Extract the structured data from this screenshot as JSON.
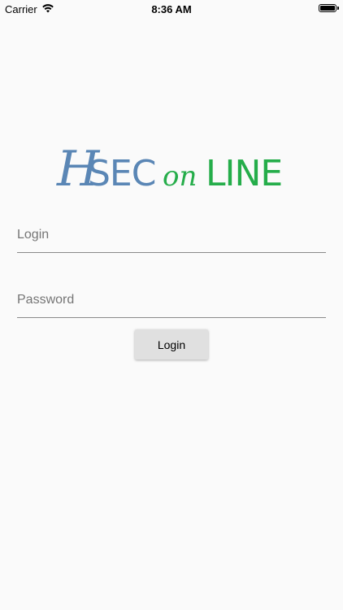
{
  "status_bar": {
    "carrier": "Carrier",
    "time": "8:36 AM"
  },
  "logo": {
    "part_h": "H",
    "part_sec": "SEC",
    "part_on": "on",
    "part_line": "LINE",
    "colors": {
      "blue": "#5a86b5",
      "green": "#25ad4a"
    }
  },
  "form": {
    "login_placeholder": "Login",
    "login_value": "",
    "password_placeholder": "Password",
    "password_value": "",
    "button_label": "Login"
  }
}
